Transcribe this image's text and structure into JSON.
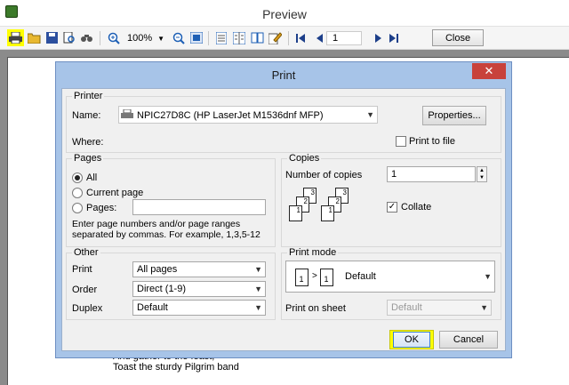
{
  "window": {
    "title": "Preview"
  },
  "toolbar": {
    "zoom": "100%",
    "page": "1",
    "close_label": "Close",
    "icons": [
      "print-icon",
      "open-icon",
      "save-icon",
      "print-preview-icon",
      "find-icon",
      "zoom-in-icon",
      "zoom-out-icon",
      "fit-page-icon",
      "single-page-icon",
      "two-pages-icon",
      "book-icon",
      "edit-icon",
      "first-page-icon",
      "prev-page-icon",
      "next-page-icon",
      "last-page-icon"
    ]
  },
  "document": {
    "lines": [
      "And gather to the feast,",
      "Toast the sturdy Pilgrim band"
    ]
  },
  "dialog": {
    "title": "Print",
    "close_glyph": "✕",
    "printer": {
      "group": "Printer",
      "name_label": "Name:",
      "name_value": "NPIC27D8C (HP LaserJet M1536dnf MFP)",
      "where_label": "Where:",
      "properties_label": "Properties...",
      "print_to_file_label": "Print to file",
      "print_to_file_checked": false
    },
    "pages": {
      "group": "Pages",
      "all_label": "All",
      "current_label": "Current page",
      "pages_label": "Pages:",
      "pages_value": "",
      "selected": "All",
      "hint": "Enter page numbers and/or page ranges separated by commas. For example, 1,3,5-12"
    },
    "copies": {
      "group": "Copies",
      "number_label": "Number of copies",
      "number_value": "1",
      "collate_label": "Collate",
      "collate_checked": true,
      "page_numbers": [
        "3",
        "2",
        "1",
        "3",
        "2",
        "1"
      ]
    },
    "other": {
      "group": "Other",
      "print_label": "Print",
      "print_value": "All pages",
      "order_label": "Order",
      "order_value": "Direct (1-9)",
      "duplex_label": "Duplex",
      "duplex_value": "Default"
    },
    "print_mode": {
      "group": "Print mode",
      "mode_value": "Default",
      "mode_pages": [
        "1",
        "1"
      ],
      "mode_arrow": ">",
      "sheet_label": "Print on sheet",
      "sheet_value": "Default"
    },
    "ok_label": "OK",
    "cancel_label": "Cancel"
  },
  "colors": {
    "highlight": "#ffff00",
    "close_button": "#c8423b",
    "dialog_frame": "#a7c4e8"
  }
}
